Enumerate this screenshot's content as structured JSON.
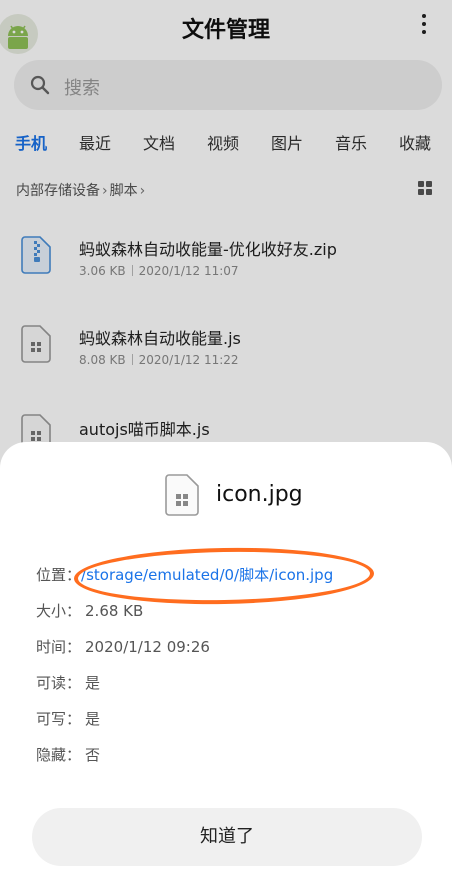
{
  "header": {
    "title": "文件管理"
  },
  "search": {
    "placeholder": "搜索"
  },
  "tabs": [
    {
      "label": "手机",
      "active": true
    },
    {
      "label": "最近"
    },
    {
      "label": "文档"
    },
    {
      "label": "视频"
    },
    {
      "label": "图片"
    },
    {
      "label": "音乐"
    },
    {
      "label": "收藏"
    }
  ],
  "breadcrumb": {
    "items": [
      "内部存储设备",
      "脚本"
    ]
  },
  "files": [
    {
      "name": "蚂蚁森林自动收能量-优化收好友.zip",
      "size": "3.06 KB",
      "date": "2020/1/12 11:07",
      "icon": "zip-file-icon"
    },
    {
      "name": "蚂蚁森林自动收能量.js",
      "size": "8.08 KB",
      "date": "2020/1/12 11:22",
      "icon": "script-file-icon"
    },
    {
      "name": "autojs喵币脚本.js",
      "size": "",
      "date": "",
      "icon": "script-file-icon"
    }
  ],
  "details": {
    "file_name": "icon.jpg",
    "location_label": "位置：",
    "location_value": "/storage/emulated/0/脚本/icon.jpg",
    "size_label": "大小：",
    "size_value": "2.68 KB",
    "time_label": "时间：",
    "time_value": "2020/1/12 09:26",
    "readable_label": "可读：",
    "readable_value": "是",
    "writable_label": "可写：",
    "writable_value": "是",
    "hidden_label": "隐藏：",
    "hidden_value": "否",
    "ok_label": "知道了"
  },
  "colors": {
    "accent": "#1a73e8",
    "annotation": "#ff6d1f"
  }
}
